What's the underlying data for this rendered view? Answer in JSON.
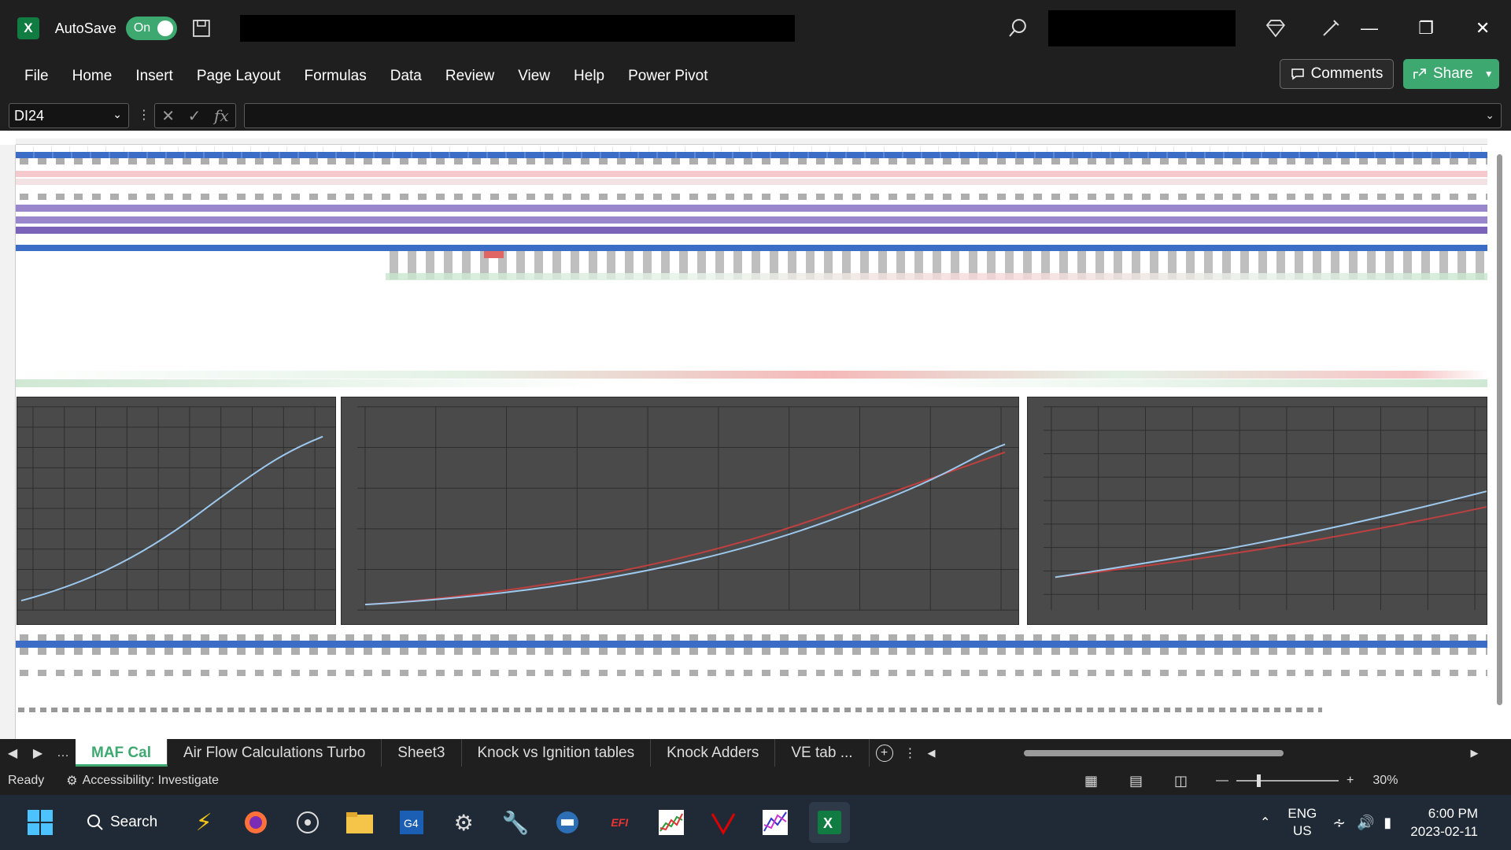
{
  "titlebar": {
    "autosave_label": "AutoSave",
    "toggle_label": "On"
  },
  "menu": [
    "File",
    "Home",
    "Insert",
    "Page Layout",
    "Formulas",
    "Data",
    "Review",
    "View",
    "Help",
    "Power Pivot"
  ],
  "buttons": {
    "comments": "Comments",
    "share": "Share"
  },
  "formula_bar": {
    "name_box": "DI24",
    "fx": "fx",
    "value": ""
  },
  "sheet_tabs": [
    "MAF Cal",
    "Air Flow Calculations Turbo",
    "Sheet3",
    "Knock vs Ignition tables",
    "Knock Adders",
    "VE tab ..."
  ],
  "active_tab": "MAF Cal",
  "status": {
    "ready": "Ready",
    "accessibility": "Accessibility: Investigate",
    "zoom": "30%"
  },
  "taskbar": {
    "search_label": "Search",
    "lang_top": "ENG",
    "lang_bottom": "US",
    "time": "6:00 PM",
    "date": "2023-02-11"
  },
  "colors": {
    "accent": "#3da870",
    "excel": "#107c41",
    "blue_row": "#3b6dc7",
    "purple_row": "#7a63b8",
    "pink_row": "#f6c9cc",
    "chart_bg": "#4a4a4a",
    "series1": "#9ec9ee",
    "series2": "#d04040"
  },
  "icons": [
    "excel-icon",
    "save-icon",
    "search-icon",
    "diamond-icon",
    "pen-icon",
    "comment-icon",
    "share-icon",
    "chevron-down-icon",
    "sheet-add-icon",
    "normal-view-icon",
    "page-layout-icon",
    "page-break-icon",
    "windows-start-icon"
  ]
}
